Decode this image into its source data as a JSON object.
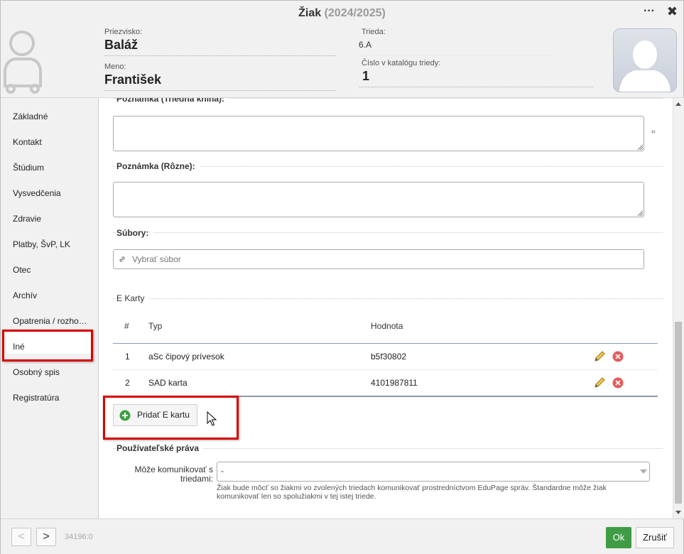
{
  "window": {
    "title": "Žiak",
    "school_year": "(2024/2025)",
    "more_icon": "more-icon",
    "close_icon": "close-icon"
  },
  "header": {
    "surname_label": "Priezvisko:",
    "surname": "Baláž",
    "name_label": "Meno:",
    "name": "František",
    "class_label": "Trieda:",
    "class": "6.A",
    "catalog_label": "Číslo v katalógu triedy:",
    "catalog_number": "1"
  },
  "sidebar": {
    "items": [
      {
        "label": "Základné"
      },
      {
        "label": "Kontakt"
      },
      {
        "label": "Štúdium"
      },
      {
        "label": "Vysvedčenia"
      },
      {
        "label": "Zdravie"
      },
      {
        "label": "Platby, ŠvP, LK"
      },
      {
        "label": "Otec"
      },
      {
        "label": "Archív"
      },
      {
        "label": "Opatrenia / rozho…"
      },
      {
        "label": "Iné"
      },
      {
        "label": "Osobný spis"
      },
      {
        "label": "Registratúra"
      }
    ],
    "active": "Iné"
  },
  "content": {
    "note_class_book_label": "Poznámka (Triedna kniha):",
    "hash_symbol": "⌗",
    "note_misc_label": "Poznámka (Rôzne):",
    "files_label": "Súbory:",
    "file_placeholder": "Vybrať súbor",
    "ecards": {
      "title": "E Karty",
      "columns": [
        "#",
        "Typ",
        "Hodnota"
      ],
      "rows": [
        {
          "num": "1",
          "type": "aSc čipový prívesok",
          "value": "b5f30802"
        },
        {
          "num": "2",
          "type": "SAD karta",
          "value": "4101987811"
        }
      ],
      "add_button": "Pridať E kartu"
    },
    "rights": {
      "title": "Používateľské práva",
      "communicate_label_line1": "Môže komunikovať s",
      "communicate_label_line2": "triedami:",
      "communicate_value": "-",
      "hint_line1": "Žiak bude môcť so žiakmi vo zvolených triedach komunikovať prostredníctvom EduPage správ. Štandardne môže žiak",
      "hint_line2": "komunikovať len so spolužiakmi v tej istej triede."
    }
  },
  "footer": {
    "prev_label": "<",
    "next_label": ">",
    "record_id": "34196:0",
    "ok_label": "Ok",
    "cancel_label": "Zrušiť"
  },
  "colors": {
    "highlight_red": "#d80000",
    "ok_green": "#3f9c44",
    "delete_red": "#e45b5b",
    "add_green": "#3ea043"
  }
}
